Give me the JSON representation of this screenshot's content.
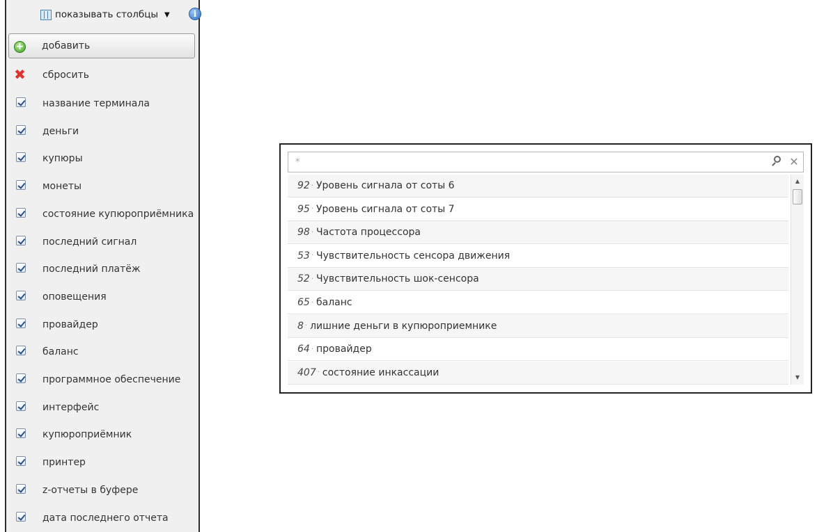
{
  "menu": {
    "columns_button_label": "показывать столбцы",
    "info_icon_glyph": "i",
    "add_label": "добавить",
    "reset_label": "сбросить",
    "columns": [
      {
        "label": "название терминала",
        "checked": true
      },
      {
        "label": "деньги",
        "checked": true
      },
      {
        "label": "купюры",
        "checked": true
      },
      {
        "label": "монеты",
        "checked": true
      },
      {
        "label": "состояние купюроприёмника",
        "checked": true
      },
      {
        "label": "последний сигнал",
        "checked": true
      },
      {
        "label": "последний платёж",
        "checked": true
      },
      {
        "label": "оповещения",
        "checked": true
      },
      {
        "label": "провайдер",
        "checked": true
      },
      {
        "label": "баланс",
        "checked": true
      },
      {
        "label": "программное обеспечение",
        "checked": true
      },
      {
        "label": "интерфейс",
        "checked": true
      },
      {
        "label": "купюроприёмник",
        "checked": true
      },
      {
        "label": "принтер",
        "checked": true
      },
      {
        "label": "z-отчеты в буфере",
        "checked": true
      },
      {
        "label": "дата последнего отчета",
        "checked": true
      }
    ]
  },
  "search": {
    "placeholder": "*",
    "value": ""
  },
  "results": [
    {
      "id": "92",
      "label": "Уровень сигнала от соты 6"
    },
    {
      "id": "95",
      "label": "Уровень сигнала от соты 7"
    },
    {
      "id": "98",
      "label": "Частота процессора"
    },
    {
      "id": "53",
      "label": "Чувствительность сенсора движения"
    },
    {
      "id": "52",
      "label": "Чувствительность шок-сенсора"
    },
    {
      "id": "65",
      "label": "баланс"
    },
    {
      "id": "8",
      "label": "лишние деньги в купюроприемнике"
    },
    {
      "id": "64",
      "label": "провайдер"
    },
    {
      "id": "407",
      "label": "состояние инкассации"
    }
  ],
  "colors": {
    "menu_background": "#f0f0f0",
    "add_icon": "#3f9d24",
    "reset_icon": "#e0312d",
    "info_icon": "#2f6fc0",
    "row_alt_background": "#f6f6f6"
  },
  "icons": {
    "columns_button": "columns-grid-icon",
    "add": "add-circle-icon",
    "reset": "red-x-icon",
    "info": "info-icon",
    "search": "magnifier-icon",
    "clear": "close-icon"
  }
}
